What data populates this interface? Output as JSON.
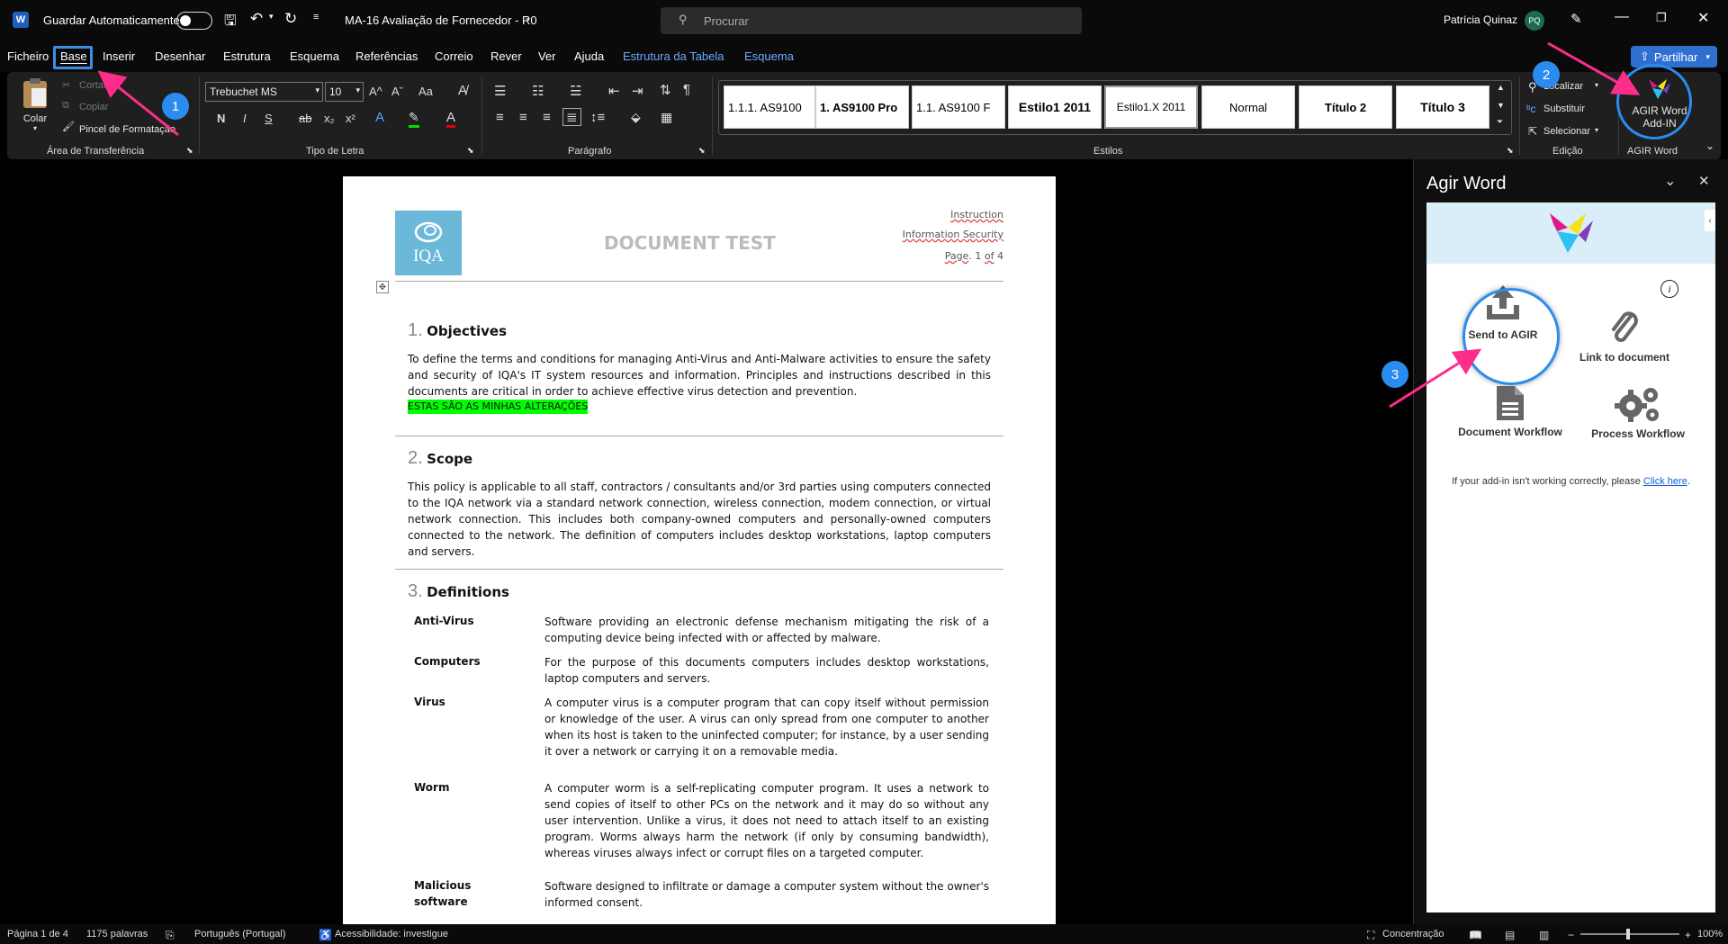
{
  "titlebar": {
    "autosave_label": "Guardar Automaticamente",
    "doc_title": "MA-16 Avaliação de Fornecedor - R0",
    "search_placeholder": "Procurar",
    "user_name": "Patrícia Quinaz",
    "user_initials": "PQ"
  },
  "menu": {
    "items": [
      "Ficheiro",
      "Base",
      "Inserir",
      "Desenhar",
      "Estrutura",
      "Esquema",
      "Referências",
      "Correio",
      "Rever",
      "Ver",
      "Ajuda"
    ],
    "context_tabs": [
      "Estrutura da Tabela",
      "Esquema"
    ],
    "share_label": "Partilhar"
  },
  "ribbon": {
    "clipboard": {
      "paste": "Colar",
      "cut": "Cortar",
      "copy": "Copiar",
      "format_painter": "Pincel de Formatação",
      "label": "Área de Transferência"
    },
    "font": {
      "family": "Trebuchet MS",
      "size": "10",
      "label": "Tipo de Letra",
      "bold": "N",
      "italic": "I",
      "underline": "S",
      "strike": "ab",
      "sub": "x₂",
      "sup": "x²",
      "grow": "A^",
      "shrink": "Aˇ",
      "case": "Aa"
    },
    "paragraph": {
      "label": "Parágrafo"
    },
    "styles": {
      "label": "Estilos",
      "items": [
        "1.1.1.  AS9100",
        "1.  AS9100 Pro",
        "1.1.  AS9100 F",
        "Estilo1 2011",
        "Estilo1.X 2011",
        "Normal",
        "Título 2",
        "Título 3"
      ]
    },
    "editing": {
      "find": "Localizar",
      "replace": "Substituir",
      "select": "Selecionar",
      "label": "Edição"
    },
    "addin": {
      "button_line1": "AGIR Word",
      "button_line2": "Add-IN",
      "label": "AGIR Word"
    }
  },
  "document": {
    "logo_text": "IQA",
    "header_title": "DOCUMENT TEST",
    "header_right": {
      "line1": "Instruction",
      "line2": "Information Security",
      "page_prefix": "Page",
      "page_num": "1",
      "page_of": "of",
      "page_total": "4"
    },
    "sections": [
      {
        "num": "1.",
        "title": "Objectives",
        "body": "To define the terms and conditions for managing Anti-Virus and Anti-Malware activities to ensure the safety and security of IQA's IT system resources and information. Principles and instructions described in this documents are critical in order to achieve effective virus detection and prevention.",
        "highlight": "ESTAS SÃO AS MINHAS ALTERAÇÕES"
      },
      {
        "num": "2.",
        "title": "Scope",
        "body": "This policy is applicable to all staff, contractors / consultants and/or 3rd parties using computers connected to the IQA network via a standard network connection, wireless connection, modem connection, or virtual network connection. This includes both company-owned computers and personally-owned computers connected to the network. The definition of computers includes desktop workstations, laptop computers and servers."
      },
      {
        "num": "3.",
        "title": "Definitions"
      }
    ],
    "definitions": [
      {
        "term": "Anti-Virus",
        "text": "Software providing an electronic defense mechanism mitigating the risk of a computing device being infected with or affected by malware."
      },
      {
        "term": "Computers",
        "text": "For the purpose of this documents computers includes desktop workstations, laptop computers and servers."
      },
      {
        "term": "Virus",
        "text": "A computer virus is a computer program that can copy itself without permission or knowledge of the user. A virus can only spread from one computer to another when its host is taken to the uninfected computer; for instance, by a user sending it over a network or carrying it on a removable media."
      },
      {
        "term": "Worm",
        "text": "A computer worm is a self-replicating computer program. It uses a network to send copies of itself to other PCs on the network and it may do so without any user intervention. Unlike a virus, it does not need to attach itself to an existing program. Worms always harm the network (if only by consuming bandwidth), whereas viruses always infect or corrupt files on a targeted computer."
      },
      {
        "term": "Malicious software",
        "text": "Software designed to infiltrate or damage a computer system without the owner's informed consent."
      }
    ]
  },
  "pane": {
    "title": "Agir Word",
    "send": "Send to AGIR",
    "link": "Link to document",
    "doc_workflow": "Document Workflow",
    "process_workflow": "Process Workflow",
    "help_text": "If your add-in isn't working correctly, please",
    "help_link": "Click here",
    "help_end": "."
  },
  "statusbar": {
    "page": "Página 1 de 4",
    "words": "1175 palavras",
    "language": "Português (Portugal)",
    "accessibility": "Acessibilidade: investigue",
    "focus": "Concentração",
    "zoom": "100%"
  },
  "annotations": {
    "badge1": "1",
    "badge2": "2",
    "badge3": "3",
    "accent": "#2b8cf0",
    "arrow_color": "#ff2d8a"
  }
}
